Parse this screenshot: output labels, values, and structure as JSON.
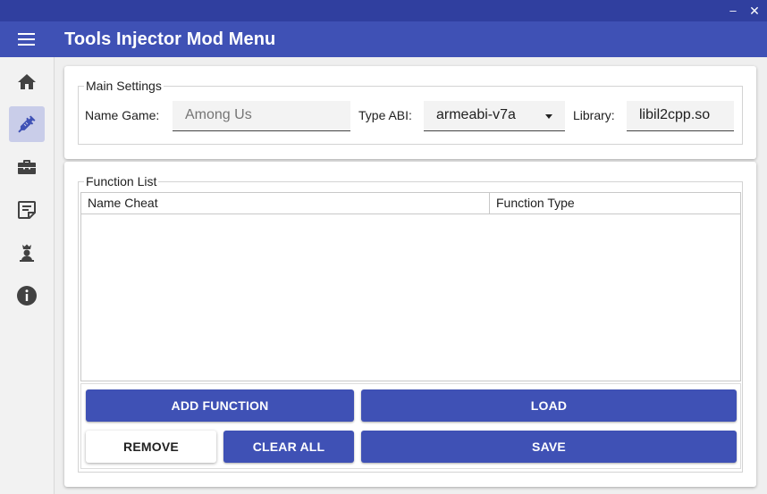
{
  "window": {
    "minimize_glyph": "–",
    "close_glyph": "✕"
  },
  "appbar": {
    "title": "Tools Injector Mod Menu",
    "menu_icon": "hamburger-menu-icon"
  },
  "sidebar": {
    "items": [
      {
        "icon": "home-icon",
        "active": false
      },
      {
        "icon": "syringe-icon",
        "active": true
      },
      {
        "icon": "toolbox-icon",
        "active": false
      },
      {
        "icon": "notes-icon",
        "active": false
      },
      {
        "icon": "chess-king-icon",
        "active": false
      },
      {
        "icon": "info-icon",
        "active": false
      }
    ],
    "active_color": "#c9cde9"
  },
  "main_settings": {
    "legend": "Main Settings",
    "name_game_label": "Name Game:",
    "name_game_value": "Among Us",
    "type_abi_label": "Type ABI:",
    "type_abi_value": "armeabi-v7a",
    "library_label": "Library:",
    "library_value": "libil2cpp.so"
  },
  "function_list": {
    "legend": "Function List",
    "columns": [
      "Name Cheat",
      "Function Type"
    ],
    "rows": []
  },
  "buttons": {
    "add_function": "ADD FUNCTION",
    "load": "LOAD",
    "remove": "REMOVE",
    "clear_all": "CLEAR ALL",
    "save": "SAVE"
  },
  "colors": {
    "primary": "#3f51b5",
    "primary_dark": "#303f9f"
  }
}
